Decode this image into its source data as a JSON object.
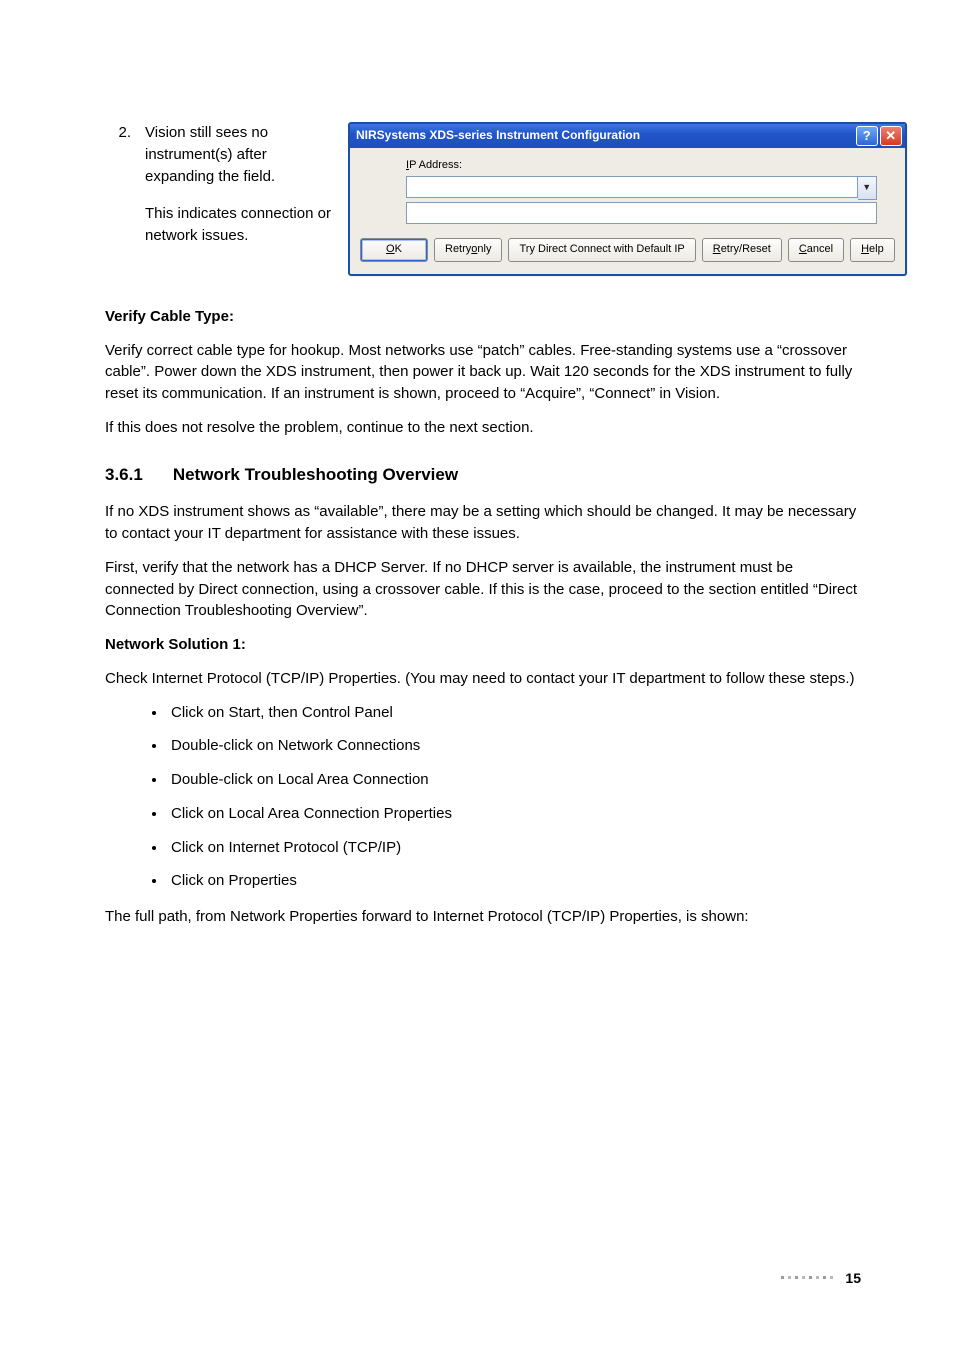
{
  "list": {
    "number": "2.",
    "para1": "Vision still sees no instrument(s) after expanding the field.",
    "para2": "This indicates connection or network issues."
  },
  "dialog": {
    "title": "NIRSystems XDS-series Instrument Configuration",
    "help_btn": "?",
    "close_btn": "✕",
    "ip_label_underline": "I",
    "ip_label_rest": "P Address:",
    "combo_arrow": "▼",
    "buttons": {
      "ok_u": "O",
      "ok_rest": "K",
      "retry_only_pre": "Retry ",
      "retry_only_u": "o",
      "retry_only_post": "nly",
      "try_direct": "Try Direct Connect with Default IP",
      "retry_reset_u": "R",
      "retry_reset_rest": "etry/Reset",
      "cancel_u": "C",
      "cancel_rest": "ancel",
      "help_u": "H",
      "help_rest": "elp"
    }
  },
  "body": {
    "verify_heading": "Verify Cable Type:",
    "verify_para": "Verify correct cable type for hookup. Most networks use “patch” cables. Free-standing systems use a “crossover cable”. Power down the XDS instrument, then power it back up. Wait 120 seconds for the XDS instrument to fully reset its communication. If an instrument is shown, proceed to “Acquire”, “Connect” in Vision.",
    "verify_para2": "If this does not resolve the problem, continue to the next section.",
    "section_num": "3.6.1",
    "section_title": "Network Troubleshooting Overview",
    "net_para1": "If no XDS instrument shows as “available”, there may be a setting which should be changed. It may be necessary to contact your IT department for assistance with these issues.",
    "net_para2": "First, verify that the network has a DHCP Server. If no DHCP server is available, the instrument must be connected by Direct connection, using a crossover cable. If this is the case, proceed to the section entitled “Direct Connection Troubleshooting Overview”.",
    "sol_heading": "Network Solution 1:",
    "sol_para": "Check Internet Protocol (TCP/IP) Properties. (You may need to contact your IT department to follow these steps.)",
    "bullets": [
      "Click on Start, then Control Panel",
      "Double-click on Network Connections",
      "Double-click on Local Area Connection",
      "Click on Local Area Connection Properties",
      "Click on Internet Protocol (TCP/IP)",
      "Click on Properties"
    ],
    "closing": "The full path, from Network Properties forward to Internet Protocol (TCP/IP) Properties, is shown:"
  },
  "footer": {
    "page": "15"
  }
}
